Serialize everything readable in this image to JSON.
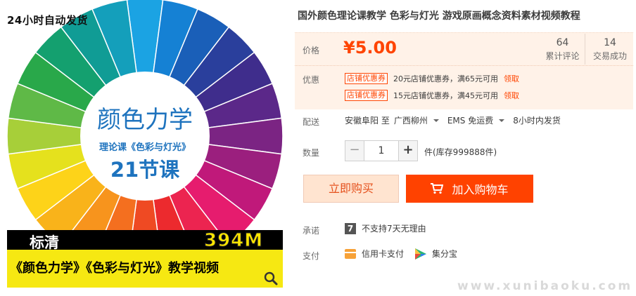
{
  "image": {
    "shipping_note": "24小时自动发货",
    "wheel_title": "颜色力学",
    "wheel_subtitle": "理论课《色彩与灯光》",
    "wheel_lessons": "21节课",
    "quality": "标清",
    "size": "394M",
    "banner": "《颜色力学》《色彩与灯光》教学视频",
    "wheel_colors": [
      "#1ba3e3",
      "#1581d4",
      "#1a5fb8",
      "#2a3f9c",
      "#3f2d8c",
      "#5b2889",
      "#7b2483",
      "#9b1f7e",
      "#c0197a",
      "#e61c6e",
      "#ec2450",
      "#ec2a2e",
      "#ef4a23",
      "#f46f1f",
      "#f7941d",
      "#f9b31a",
      "#fdd319",
      "#e5e11d",
      "#a7cf39",
      "#5fb947",
      "#29a84a",
      "#14a06f",
      "#109c95",
      "#149fbb"
    ]
  },
  "product": {
    "title": "国外颜色理论课教学 色彩与灯光 游戏原画概念资料素材视频教程"
  },
  "price": {
    "label": "价格",
    "value": "¥5.00",
    "reviews_count": "64",
    "reviews_label": "累计评论",
    "sales_count": "14",
    "sales_label": "交易成功"
  },
  "promotions": {
    "label": "优惠",
    "items": [
      {
        "tag": "店铺优惠券",
        "text": "20元店铺优惠券，满65元可用",
        "link": "领取"
      },
      {
        "tag": "店铺优惠券",
        "text": "15元店铺优惠券，满45元可用",
        "link": "领取"
      }
    ]
  },
  "delivery": {
    "label": "配送",
    "from": "安徽阜阳 至",
    "to": "广西柳州",
    "method": "EMS 免运费",
    "time": "8小时内发货"
  },
  "quantity": {
    "label": "数量",
    "minus": "−",
    "value": "1",
    "plus": "+",
    "stock": "件(库存999888件)"
  },
  "buttons": {
    "buy_now": "立即购买",
    "add_cart": "加入购物车"
  },
  "promise": {
    "label": "承诺",
    "icon_text": "7",
    "text": "不支持7天无理由"
  },
  "payment": {
    "label": "支付",
    "methods": [
      "信用卡支付",
      "集分宝"
    ]
  },
  "watermark": "www.xunibaoku.com",
  "colors": {
    "accent": "#ff4400",
    "price_bg": "#fff2e8",
    "buy_bg": "#ffe4d0",
    "cart_bg": "#ff4200"
  }
}
